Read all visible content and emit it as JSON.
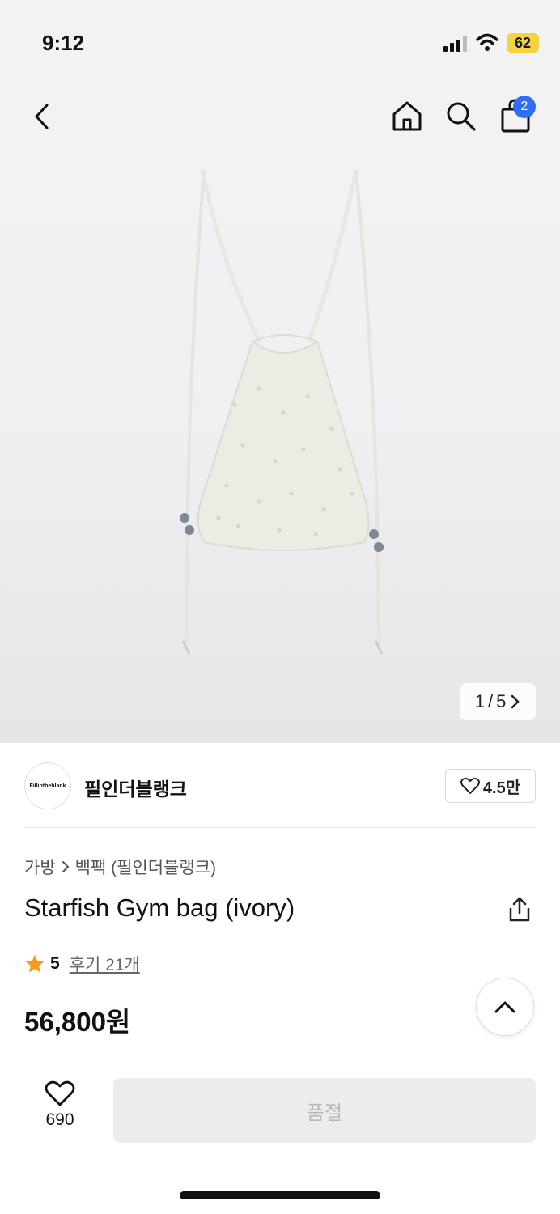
{
  "status_bar": {
    "time": "9:12",
    "battery": "62"
  },
  "header": {
    "cart_count": "2"
  },
  "gallery": {
    "current": "1",
    "separator": "/",
    "total": "5"
  },
  "brand": {
    "logo_text": "Fillintheblank",
    "name": "필인더블랭크",
    "likes": "4.5만"
  },
  "breadcrumb": {
    "category": "가방",
    "subcategory": "백팩 (필인더블랭크)"
  },
  "product": {
    "title": "Starfish Gym bag (ivory)",
    "rating": "5",
    "review_link": "후기 21개",
    "price": "56,800원"
  },
  "bottom_bar": {
    "wish_count": "690",
    "status_button": "품절"
  },
  "colors": {
    "accent_blue": "#2f6ef5",
    "star_orange": "#f59a1b",
    "battery_yellow": "#f5d342"
  }
}
